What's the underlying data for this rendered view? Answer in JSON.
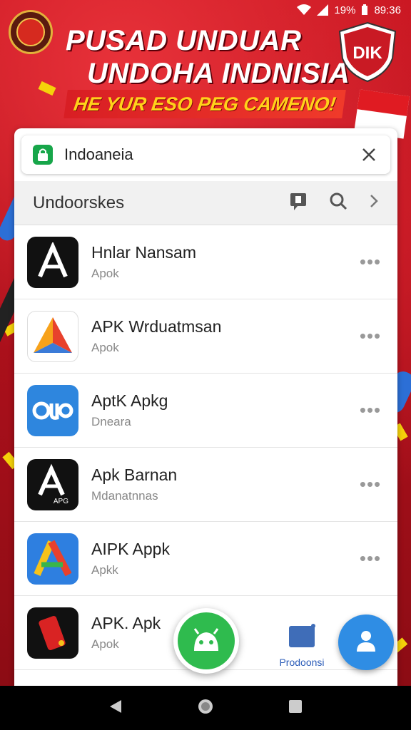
{
  "status_bar": {
    "battery": "19%",
    "time": "89:36"
  },
  "banner": {
    "title_line1": "PUSAD UNDUAR",
    "title_line2": "UNDOHA INDNISIA",
    "tagline": "HE YUR ESO PEG CAMENO!",
    "badge": "DIK"
  },
  "search": {
    "query": "Indoaneia"
  },
  "section": {
    "title": "Undoorskes"
  },
  "apps": [
    {
      "name": "Hnlar Nansam",
      "subtitle": "Apok",
      "icon": "a-letter-icon"
    },
    {
      "name": "APK Wrduatmsan",
      "subtitle": "Apok",
      "icon": "triangle-logo-icon"
    },
    {
      "name": "AptK Apkg",
      "subtitle": "Dneara",
      "icon": "qup-logo-icon"
    },
    {
      "name": "Apk Barnan",
      "subtitle": "Mdanatnnas",
      "icon": "a-apg-icon",
      "icon_text": "APG"
    },
    {
      "name": "AIPK Appk",
      "subtitle": "Apkk",
      "icon": "colorful-a-icon"
    },
    {
      "name": "APK. Apk",
      "subtitle": "Apok",
      "icon": "red-device-icon"
    }
  ],
  "bottom": {
    "downloads_label": "Prodoonsi"
  },
  "colors": {
    "brand_red": "#c7141f",
    "tagline_yellow": "#ffd21a",
    "fab_green": "#2fbb4e",
    "fab_blue": "#2f8de4"
  }
}
